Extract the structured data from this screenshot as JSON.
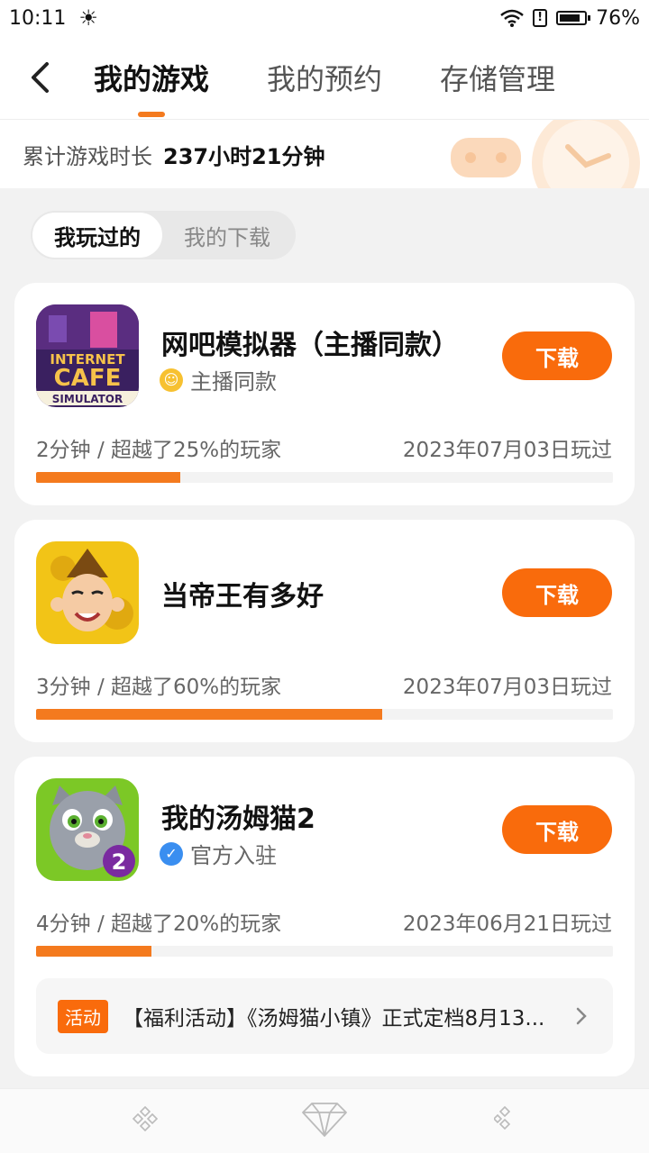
{
  "status": {
    "time": "10:11",
    "battery": "76%"
  },
  "header": {
    "tabs": [
      {
        "label": "我的游戏",
        "active": true
      },
      {
        "label": "我的预约",
        "active": false
      },
      {
        "label": "存储管理",
        "active": false
      }
    ]
  },
  "summary": {
    "label": "累计游戏时长",
    "value": "237小时21分钟"
  },
  "filter": {
    "options": [
      "我玩过的",
      "我的下载"
    ],
    "selected": "我玩过的"
  },
  "games": [
    {
      "title": "网吧模拟器（主播同款）",
      "tag": "主播同款",
      "tag_icon": "streamer-face-icon",
      "button": "下载",
      "stats": "2分钟 / 超越了25%的玩家",
      "played": "2023年07月03日玩过",
      "progress": 0.25
    },
    {
      "title": "当帝王有多好",
      "tag": "",
      "button": "下载",
      "stats": "3分钟 / 超越了60%的玩家",
      "played": "2023年07月03日玩过",
      "progress": 0.6
    },
    {
      "title": "我的汤姆猫2",
      "tag": "官方入驻",
      "tag_icon": "verified-badge-icon",
      "button": "下载",
      "stats": "4分钟 / 超越了20%的玩家",
      "played": "2023年06月21日玩过",
      "progress": 0.2,
      "activity": {
        "badge": "活动",
        "text": "【福利活动】《汤姆猫小镇》正式定档8月13..."
      }
    }
  ],
  "icon_art": {
    "game0": {
      "line1": "INTERNET",
      "line2": "CAFE",
      "line3": "SIMULATOR"
    },
    "game2": {
      "badge": "2"
    }
  },
  "colors": {
    "accent": "#f96b0c",
    "progress": "#f47a1e",
    "background": "#f2f2f2"
  }
}
